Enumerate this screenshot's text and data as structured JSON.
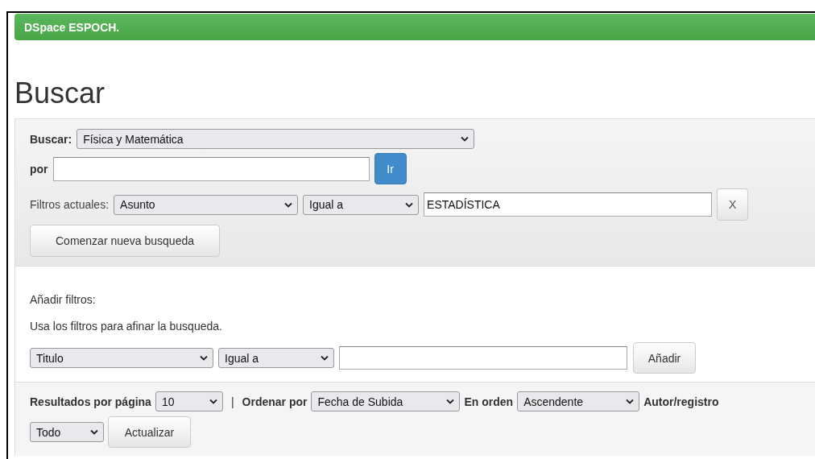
{
  "navbar": {
    "brand": "DSpace ESPOCH."
  },
  "heading": "Buscar",
  "search": {
    "scope_label": "Buscar:",
    "scope": "Física y Matemática",
    "query_label": "por",
    "go_button": "Ir"
  },
  "current_filters": {
    "label": "Filtros actuales:",
    "filters": [
      {
        "field": "Asunto",
        "operator": "Igual a",
        "value": "ESTADÍSTICA",
        "remove_button": "X"
      }
    ]
  },
  "new_search_button": "Comenzar nueva busqueda",
  "add_filters": {
    "title": "Añadir filtros:",
    "hint": "Usa los filtros para afinar la busqueda.",
    "field": "Titulo",
    "operator": "Igual a",
    "add_button": "Añadir"
  },
  "results": {
    "per_page_label": "Resultados por página",
    "per_page": "10",
    "separator": "|",
    "sort_label": "Ordenar por",
    "sort": "Fecha de Subida",
    "order_label": "En orden",
    "order": "Ascendente",
    "etal_label": "Autor/registro",
    "etal": "Todo",
    "update_button": "Actualizar"
  }
}
